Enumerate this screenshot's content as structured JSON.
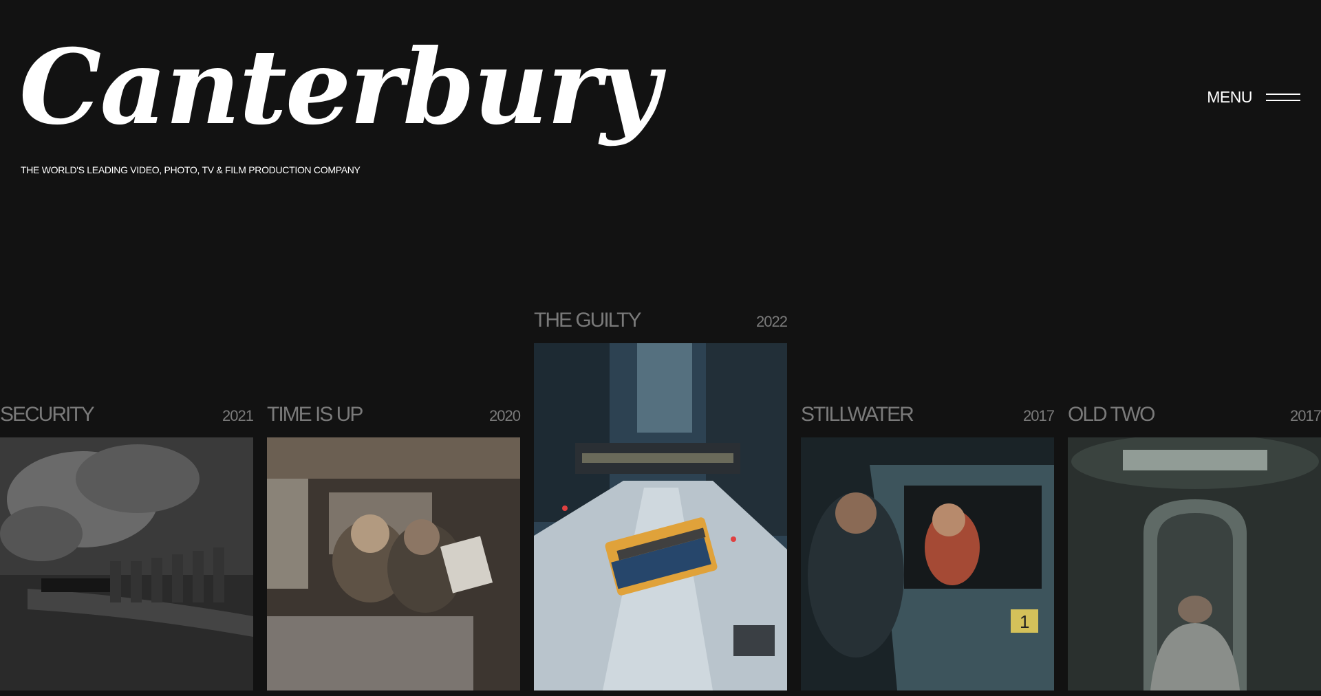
{
  "brand": {
    "logo": "Canterbury",
    "tagline": "THE WORLD'S LEADING VIDEO, PHOTO, TV & FILM PRODUCTION COMPANY"
  },
  "menu": {
    "label": "MENU",
    "icon": "hamburger-icon"
  },
  "projects": [
    {
      "title": "SECURITY",
      "year": "2021"
    },
    {
      "title": "TIME IS UP",
      "year": "2020"
    },
    {
      "title": "THE GUILTY",
      "year": "2022"
    },
    {
      "title": "STILLWATER",
      "year": "2017"
    },
    {
      "title": "OLD TWO",
      "year": "2017"
    }
  ],
  "colors": {
    "background": "#121212",
    "text": "#ffffff",
    "muted": "#7a7a7a"
  }
}
